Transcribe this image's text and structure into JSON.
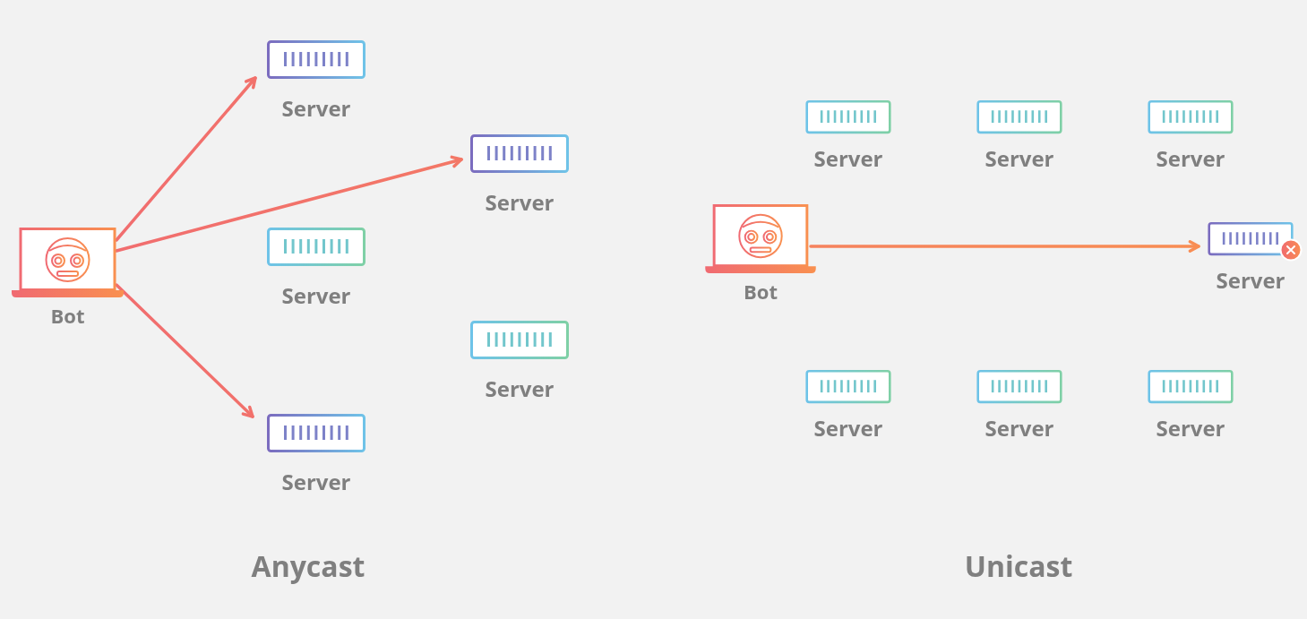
{
  "panels": [
    {
      "title": "Anycast",
      "bot": {
        "label": "Bot"
      },
      "servers": [
        {
          "label": "Server",
          "targeted": true,
          "failed": false
        },
        {
          "label": "Server",
          "targeted": true,
          "failed": false
        },
        {
          "label": "Server",
          "targeted": false,
          "failed": false
        },
        {
          "label": "Server",
          "targeted": false,
          "failed": false
        },
        {
          "label": "Server",
          "targeted": true,
          "failed": false
        }
      ]
    },
    {
      "title": "Unicast",
      "bot": {
        "label": "Bot"
      },
      "servers": [
        {
          "label": "Server",
          "targeted": false,
          "failed": false
        },
        {
          "label": "Server",
          "targeted": false,
          "failed": false
        },
        {
          "label": "Server",
          "targeted": false,
          "failed": false
        },
        {
          "label": "Server",
          "targeted": true,
          "failed": true
        },
        {
          "label": "Server",
          "targeted": false,
          "failed": false
        },
        {
          "label": "Server",
          "targeted": false,
          "failed": false
        },
        {
          "label": "Server",
          "targeted": false,
          "failed": false
        }
      ]
    }
  ]
}
